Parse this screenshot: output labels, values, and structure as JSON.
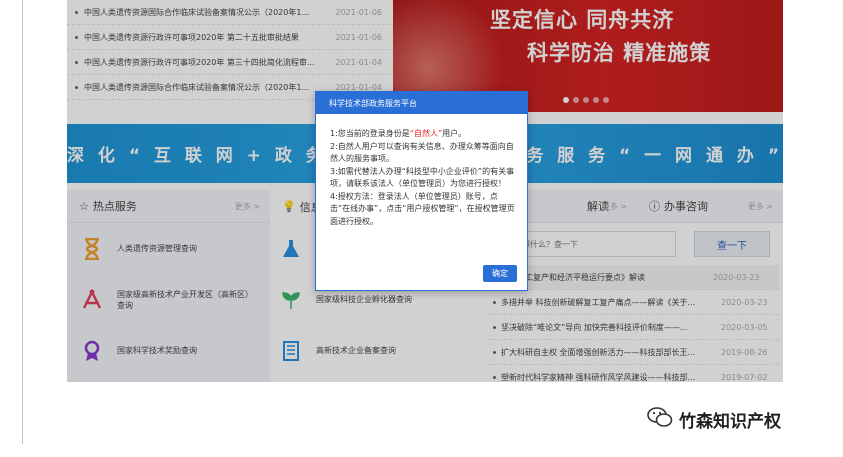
{
  "news": [
    {
      "title": "中国人类遗传资源国际合作临床试验备案情况公示（2020年1...",
      "date": "2021-01-06"
    },
    {
      "title": "中国人类遗传资源行政许可事项2020年 第二十五批审批结果",
      "date": "2021-01-06"
    },
    {
      "title": "中国人类遗传资源行政许可事项2020年 第三十四批简化流程审...",
      "date": "2021-01-04"
    },
    {
      "title": "中国人类遗传资源国际合作临床试验备案情况公示（2020年1...",
      "date": "2021-01-04"
    }
  ],
  "banner": {
    "line1": "坚定信心 同舟共济",
    "line2": "科学防治 精准施策",
    "slide_count": 5,
    "active_slide": 1
  },
  "slogan": {
    "left": "深 化 “ 互 联 网 + 政 务",
    "right": "政 务 服 务 “ 一 网 通 办 ”"
  },
  "hot_services": {
    "title": "热点服务",
    "more": "更多 >",
    "items": [
      {
        "label": "人类遗传资源管理查询",
        "icon": "hourglass-icon"
      },
      {
        "label": "国家级高新技术产业开发区（高新区）查询",
        "icon": "atom-icon"
      },
      {
        "label": "国家科学技术奖励查询",
        "icon": "award-medal-icon"
      }
    ]
  },
  "info": {
    "title": "信息",
    "items": [
      {
        "label": "",
        "icon": "flask-icon"
      },
      {
        "label": "国家级科技企业孵化器查询",
        "icon": "sprout-icon"
      },
      {
        "label": "高新技术企业备案查询",
        "icon": "building-icon"
      }
    ]
  },
  "policy": {
    "title": "解读",
    "more": "更多 >",
    "search_placeholder": "了解什么？查一下",
    "search_button": "查一下",
    "items": [
      {
        "title": "新支撑复工复产和经济平稳运行要点》解读",
        "date": "2020-03-23"
      },
      {
        "title": "多措并举 科技创新破解复工复产痛点——解读《关于...",
        "date": "2020-03-23"
      },
      {
        "title": "坚决破除“唯论文”导向 加快完善科技评价制度——...",
        "date": "2020-03-05"
      },
      {
        "title": "扩大科研自主权 全面增强创新活力——科技部部长王...",
        "date": "2019-08-26"
      },
      {
        "title": "塑新时代科学家精神 强科研作风学风建设——科技部...",
        "date": "2019-07-02"
      }
    ]
  },
  "consult": {
    "title": "办事咨询",
    "more": "更多 >"
  },
  "modal": {
    "title": "科学技术部政务服务平台",
    "line1_pre": "1:您当前的登录身份是",
    "line1_role": "“自然人”",
    "line1_post": "用户。",
    "line2": "2:自然人用户可以查询有关信息、办理众筹等面向自然人的服务事项。",
    "line3": "3:如需代替法人办理“科技型中小企业评价”的有关事项，请联系该法人（单位管理员）为您进行授权！",
    "line4": "4:授权方法：登录法人（单位管理员）账号，点击“在线办事”，点击“用户授权管理”，在授权管理页面进行授权。",
    "ok": "确定"
  },
  "watermark": {
    "text": "竹森知识产权",
    "icon": "wechat-icon"
  }
}
